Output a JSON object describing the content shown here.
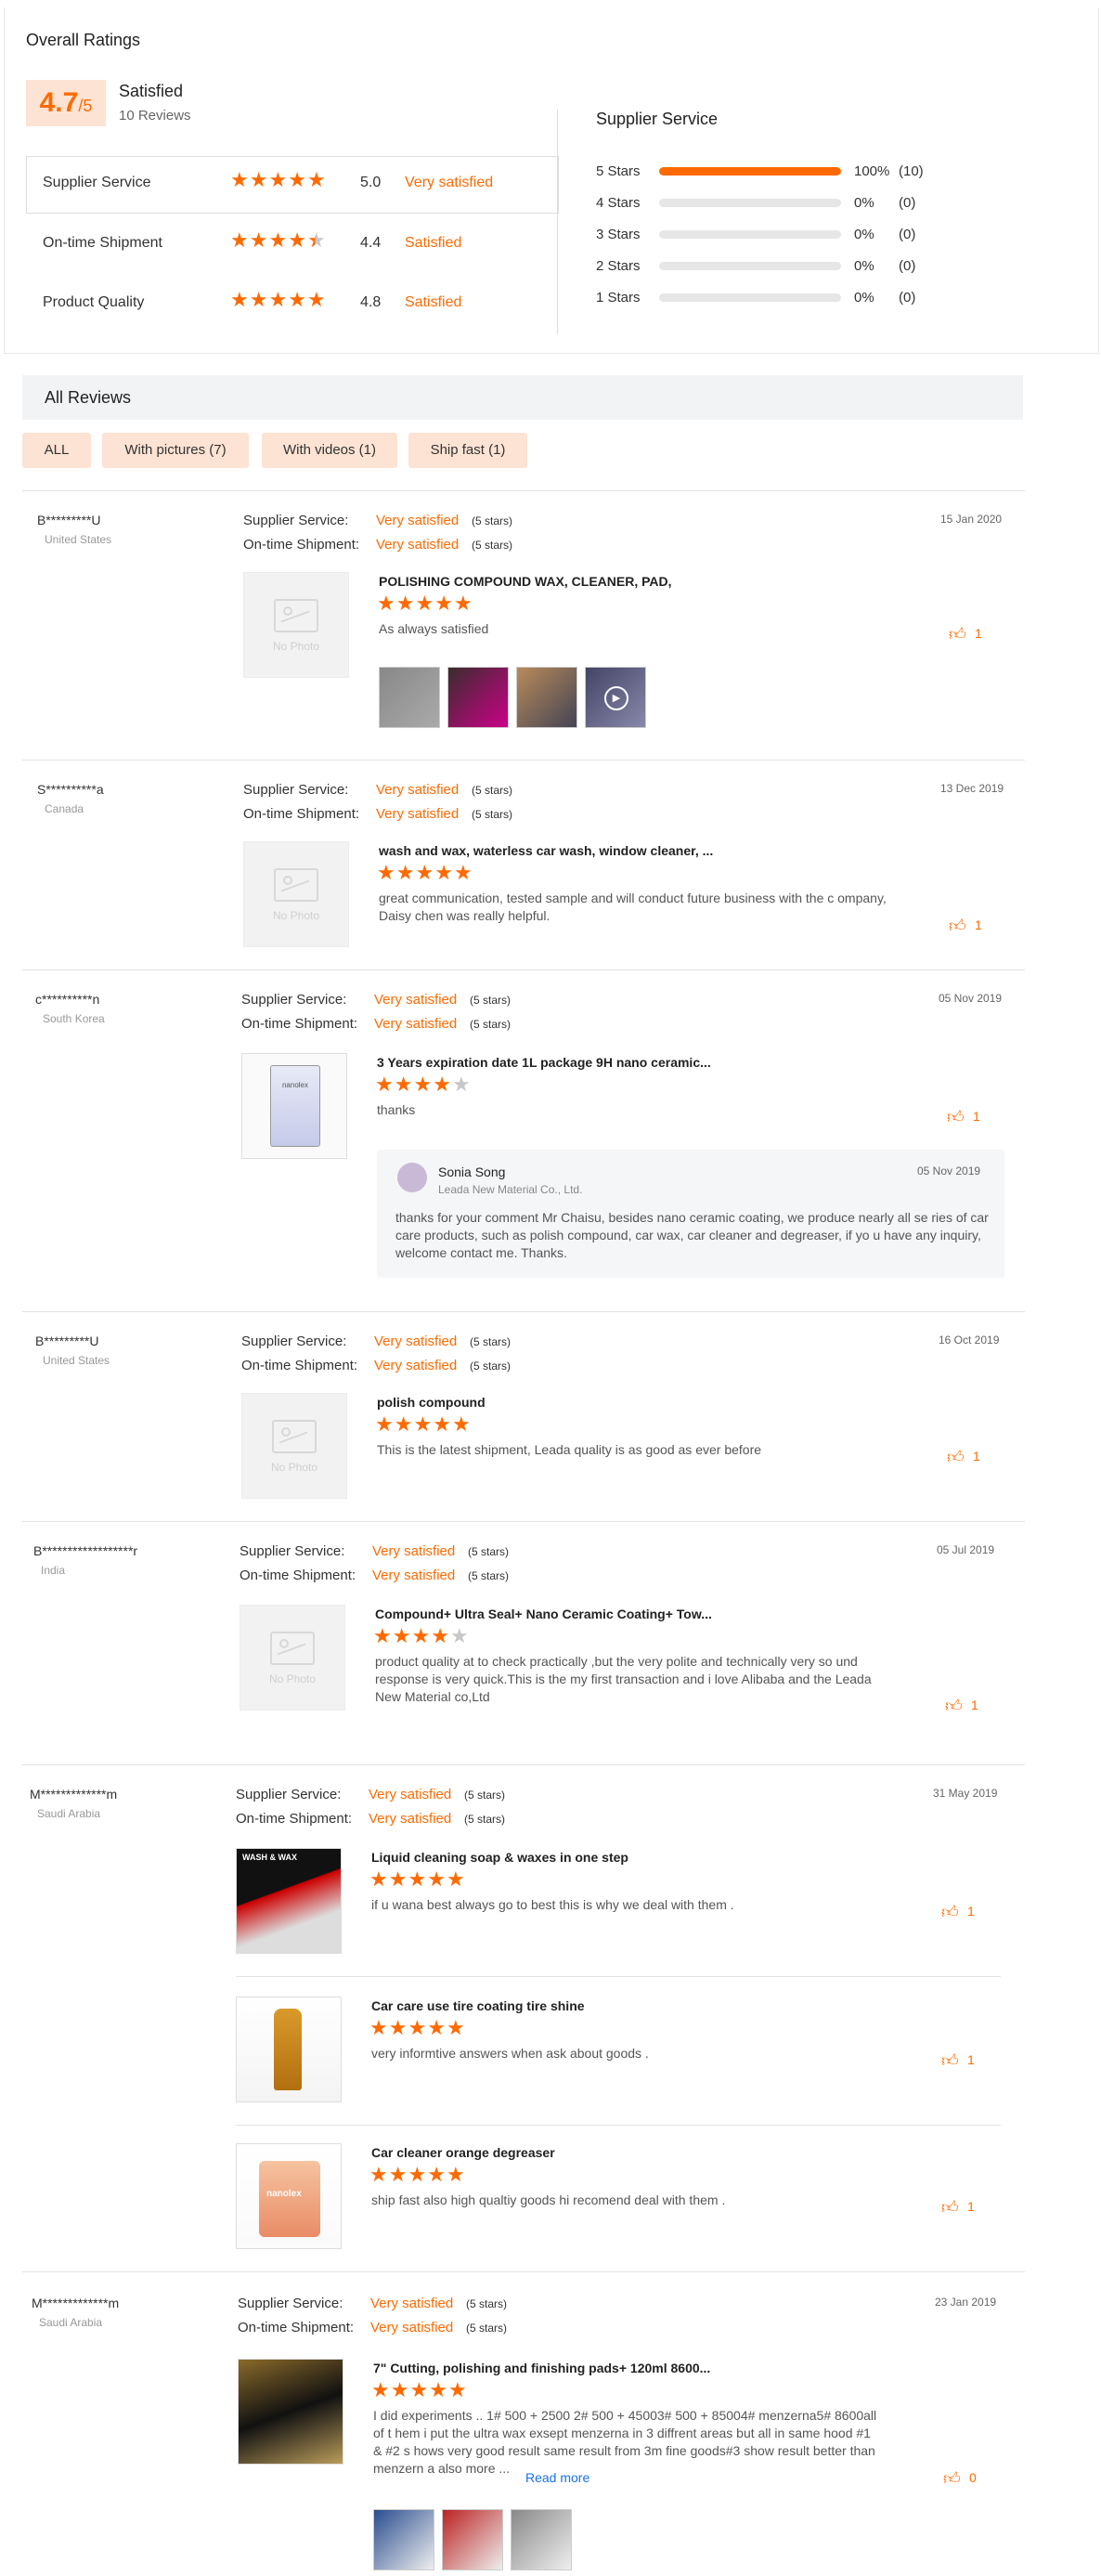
{
  "overall": {
    "heading": "Overall Ratings",
    "score": "4.7",
    "score_max": "/5",
    "summary_label": "Satisfied",
    "reviews_count": "10 Reviews",
    "rows": [
      {
        "label": "Supplier Service",
        "rating": 5.0,
        "score": "5.0",
        "verdict": "Very satisfied"
      },
      {
        "label": "On-time Shipment",
        "rating": 4.4,
        "score": "4.4",
        "verdict": "Satisfied"
      },
      {
        "label": "Product Quality",
        "rating": 4.8,
        "score": "4.8",
        "verdict": "Satisfied"
      }
    ],
    "breakdown_title": "Supplier Service",
    "breakdown": [
      {
        "label": "5 Stars",
        "fraction": 1.0,
        "pct": "100%",
        "count": "(10)"
      },
      {
        "label": "4 Stars",
        "fraction": 0.0,
        "pct": "0%",
        "count": "(0)"
      },
      {
        "label": "3 Stars",
        "fraction": 0.0,
        "pct": "0%",
        "count": "(0)"
      },
      {
        "label": "2 Stars",
        "fraction": 0.0,
        "pct": "0%",
        "count": "(0)"
      },
      {
        "label": "1 Stars",
        "fraction": 0.0,
        "pct": "0%",
        "count": "(0)"
      }
    ]
  },
  "all_reviews": {
    "heading": "All Reviews",
    "filters": [
      "ALL",
      "With pictures (7)",
      "With videos (1)",
      "Ship fast (1)"
    ]
  },
  "labels": {
    "supplier_service": "Supplier Service:",
    "on_time_shipment": "On-time Shipment:",
    "five_stars": "(5 stars)",
    "no_photo": "No Photo",
    "read_more": "Read more"
  },
  "reviews": [
    {
      "user": "B*********U",
      "country": "United States",
      "date": "15 Jan 2020",
      "supplier": "Very satisfied",
      "shipment": "Very satisfied",
      "product": "POLISHING COMPOUND WAX, CLEANER, PAD,",
      "stars": 5,
      "text": "As always satisfied",
      "likes": "1"
    },
    {
      "user": "S**********a",
      "country": "Canada",
      "date": "13 Dec 2019",
      "supplier": "Very satisfied",
      "shipment": "Very satisfied",
      "product": "wash and wax, waterless car wash, window cleaner, ...",
      "stars": 5,
      "text": "great communication, tested sample and will conduct future business with the c ompany, Daisy chen was really helpful.",
      "likes": "1"
    },
    {
      "user": "c**********n",
      "country": "South Korea",
      "date": "05 Nov 2019",
      "supplier": "Very satisfied",
      "shipment": "Very satisfied",
      "product": "3 Years expiration date 1L package 9H nano ceramic...",
      "stars": 4,
      "text": "thanks",
      "likes": "1",
      "reply": {
        "name": "Sonia Song",
        "company": "Leada New Material Co., Ltd.",
        "date": "05 Nov 2019",
        "text": "thanks for your comment Mr Chaisu, besides nano ceramic coating, we produce nearly all se ries of car care products, such as polish compound, car wax, car cleaner and degreaser, if yo u have any inquiry, welcome contact me. Thanks."
      }
    },
    {
      "user": "B*********U",
      "country": "United States",
      "date": "16 Oct 2019",
      "supplier": "Very satisfied",
      "shipment": "Very satisfied",
      "product": "polish compound",
      "stars": 5,
      "text": "This is the latest shipment, Leada quality is as good as ever before",
      "likes": "1"
    },
    {
      "user": "B******************r",
      "country": "India",
      "date": "05 Jul 2019",
      "supplier": "Very satisfied",
      "shipment": "Very satisfied",
      "product": "Compound+ Ultra Seal+ Nano Ceramic Coating+ Tow...",
      "stars": 4,
      "text": "product quality at to check practically ,but the very polite and technically very so und response is very quick.This is the my first transaction and i love Alibaba and the Leada New Material co,Ltd",
      "likes": "1"
    },
    {
      "user": "M*************m",
      "country": "Saudi Arabia",
      "date": "31 May 2019",
      "supplier": "Very satisfied",
      "shipment": "Very satisfied",
      "items": [
        {
          "product": "Liquid cleaning soap & waxes in one step",
          "stars": 5,
          "text": "if u wana best always go to best this is why we deal with them .",
          "likes": "1",
          "img_text": "WASH & WAX"
        },
        {
          "product": "Car care use tire coating tire shine",
          "stars": 5,
          "text": "very informtive answers when ask about goods .",
          "likes": "1"
        },
        {
          "product": "Car cleaner orange degreaser",
          "stars": 5,
          "text": "ship fast also high qualtiy goods hi recomend deal with them .",
          "likes": "1",
          "img_text": "nanolex"
        }
      ]
    },
    {
      "user": "M*************m",
      "country": "Saudi Arabia",
      "date": "23 Jan 2019",
      "supplier": "Very satisfied",
      "shipment": "Very satisfied",
      "product": "7\" Cutting, polishing and finishing pads+ 120ml 8600...",
      "stars": 5,
      "text": "I did experiments .. 1# 500 + 2500 2# 500 + 45003# 500 + 85004# menzerna5# 8600all of t hem i put the ultra wax exsept menzerna in 3 diffrent areas but all in same hood #1 & #2 s hows very good result same result from 3m fine goods#3 show result better than menzern a also more ...",
      "likes": "0"
    }
  ],
  "colors": {
    "accent": "#ff6a00",
    "accent_light": "#fde3d3"
  }
}
